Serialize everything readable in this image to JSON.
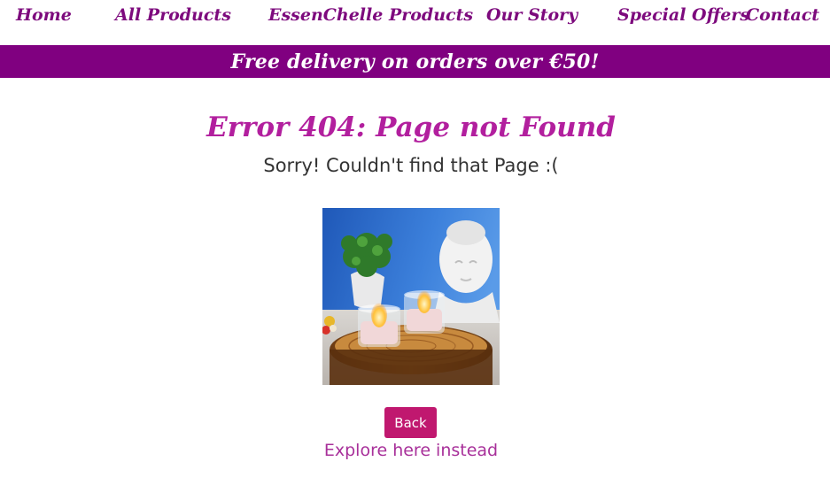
{
  "nav": {
    "items": [
      {
        "label": "Home"
      },
      {
        "label": "All Products"
      },
      {
        "label": "EssenChelle Products"
      },
      {
        "label": "Our Story"
      },
      {
        "label": "Special Offers"
      },
      {
        "label": "Contact"
      }
    ]
  },
  "banner": {
    "text": "Free delivery on orders over €50!"
  },
  "error": {
    "title": "Error 404: Page not Found",
    "subtitle": "Sorry! Couldn't find that Page :("
  },
  "image": {
    "subject": "candles-buddha-photo"
  },
  "actions": {
    "back_label": "Back",
    "explore_label": "Explore here instead"
  },
  "colors": {
    "nav_text": "#7d0a7d",
    "banner_bg": "#800080",
    "title": "#b21f9e",
    "button": "#c0186f",
    "link": "#a8309a"
  }
}
